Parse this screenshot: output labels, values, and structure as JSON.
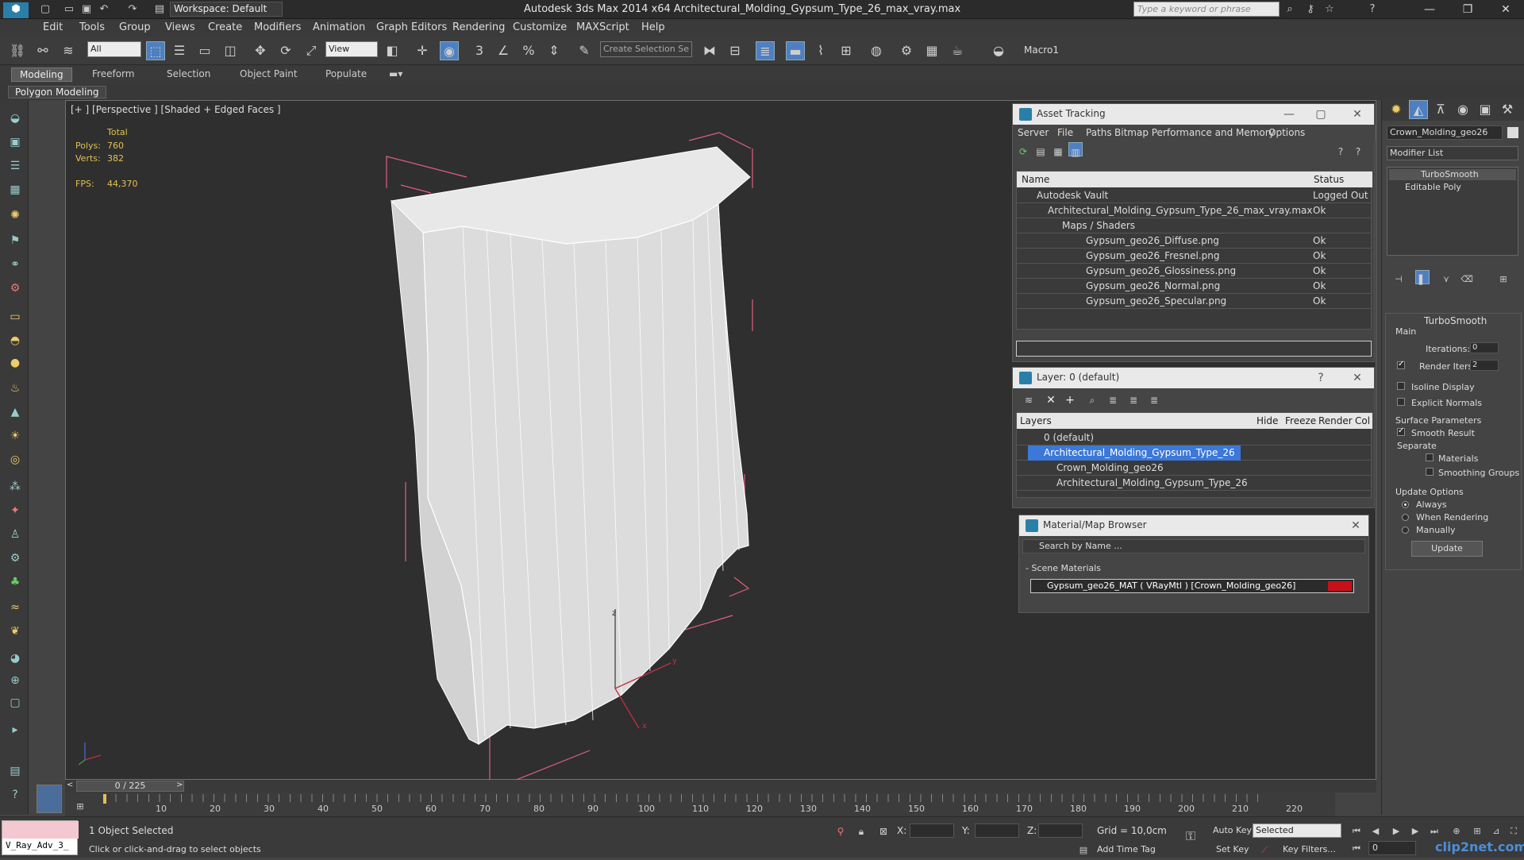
{
  "app": {
    "title": "Autodesk 3ds Max  2014 x64    Architectural_Molding_Gypsum_Type_26_max_vray.max",
    "workspace": "Workspace: Default",
    "search_placeholder": "Type a keyword or phrase"
  },
  "menu": [
    "Edit",
    "Tools",
    "Group",
    "Views",
    "Create",
    "Modifiers",
    "Animation",
    "Graph Editors",
    "Rendering",
    "Customize",
    "MAXScript",
    "Help"
  ],
  "toolbar": {
    "selection_filter": "All",
    "ref_coord": "View",
    "named_selection": "Create Selection Se",
    "macro_label": "Macro1"
  },
  "ribbon": {
    "tabs": [
      "Modeling",
      "Freeform",
      "Selection",
      "Object Paint",
      "Populate"
    ],
    "active_tab": "Modeling",
    "sub_label": "Polygon Modeling"
  },
  "viewport": {
    "label": "[+ ] [Perspective ] [Shaded + Edged Faces ]",
    "stats": {
      "total_label": "Total",
      "polys_label": "Polys:",
      "polys": "760",
      "verts_label": "Verts:",
      "verts": "382",
      "fps_label": "FPS:",
      "fps": "44,370"
    },
    "axis_z": "z",
    "axis_y": "y",
    "axis_x": "x"
  },
  "asset_tracking": {
    "title": "Asset Tracking",
    "menu": [
      "Server",
      "File",
      "Paths",
      "Bitmap Performance and Memory",
      "Options"
    ],
    "col_name": "Name",
    "col_status": "Status",
    "rows": [
      {
        "name": "Autodesk Vault",
        "status": "Logged Out"
      },
      {
        "name": "Architectural_Molding_Gypsum_Type_26_max_vray.max",
        "status": "Ok"
      },
      {
        "name": "Maps / Shaders",
        "status": ""
      },
      {
        "name": "Gypsum_geo26_Diffuse.png",
        "status": "Ok"
      },
      {
        "name": "Gypsum_geo26_Fresnel.png",
        "status": "Ok"
      },
      {
        "name": "Gypsum_geo26_Glossiness.png",
        "status": "Ok"
      },
      {
        "name": "Gypsum_geo26_Normal.png",
        "status": "Ok"
      },
      {
        "name": "Gypsum_geo26_Specular.png",
        "status": "Ok"
      }
    ]
  },
  "layer_panel": {
    "title": "Layer: 0 (default)",
    "col_layers": "Layers",
    "col_hide": "Hide",
    "col_freeze": "Freeze",
    "col_render": "Render",
    "col_color": "Col",
    "rows": [
      {
        "name": "0 (default)"
      },
      {
        "name": "Architectural_Molding_Gypsum_Type_26"
      },
      {
        "name": "Crown_Molding_geo26"
      },
      {
        "name": "Architectural_Molding_Gypsum_Type_26"
      }
    ]
  },
  "material_browser": {
    "title": "Material/Map Browser",
    "search_placeholder": "Search by Name ...",
    "section": "- Scene Materials",
    "item": "Gypsum_geo26_MAT ( VRayMtl ) [Crown_Molding_geo26]"
  },
  "command_panel": {
    "object_name": "Crown_Molding_geo26",
    "modifier_list": "Modifier List",
    "stack": [
      "TurboSmooth",
      "Editable Poly"
    ],
    "rollout_title": "TurboSmooth",
    "main_label": "Main",
    "iterations_label": "Iterations:",
    "iterations": "0",
    "render_iters_label": "Render Iters:",
    "render_iters": "2",
    "isoline": "Isoline Display",
    "explicit_normals": "Explicit Normals",
    "surface_params": "Surface Parameters",
    "smooth_result": "Smooth Result",
    "separate": "Separate",
    "materials": "Materials",
    "smoothing_groups": "Smoothing Groups",
    "update_options": "Update Options",
    "always": "Always",
    "when_rendering": "When Rendering",
    "manually": "Manually",
    "update_button": "Update"
  },
  "timeline": {
    "frame_display": "0 / 225",
    "ticks": [
      "10",
      "20",
      "30",
      "40",
      "50",
      "60",
      "70",
      "80",
      "90",
      "100",
      "110",
      "120",
      "130",
      "140",
      "150",
      "160",
      "170",
      "180",
      "190",
      "200",
      "210",
      "220"
    ]
  },
  "status": {
    "script_box": "V_Ray_Adv_3_",
    "selected": "1 Object Selected",
    "prompt": "Click or click-and-drag to select objects",
    "x_label": "X:",
    "y_label": "Y:",
    "z_label": "Z:",
    "grid": "Grid = 10,0cm",
    "add_time_tag": "Add Time Tag",
    "auto_key": "Auto Key",
    "set_key": "Set Key",
    "key_mode": "Selected",
    "key_filters": "Key Filters...",
    "frame": "0",
    "watermark": "clip2net.com"
  },
  "colors": {
    "accent": "#4f7fc0",
    "selected_row": "#3b78d8",
    "stat_text": "#e2c250",
    "wireframe_pink": "#e06080"
  }
}
